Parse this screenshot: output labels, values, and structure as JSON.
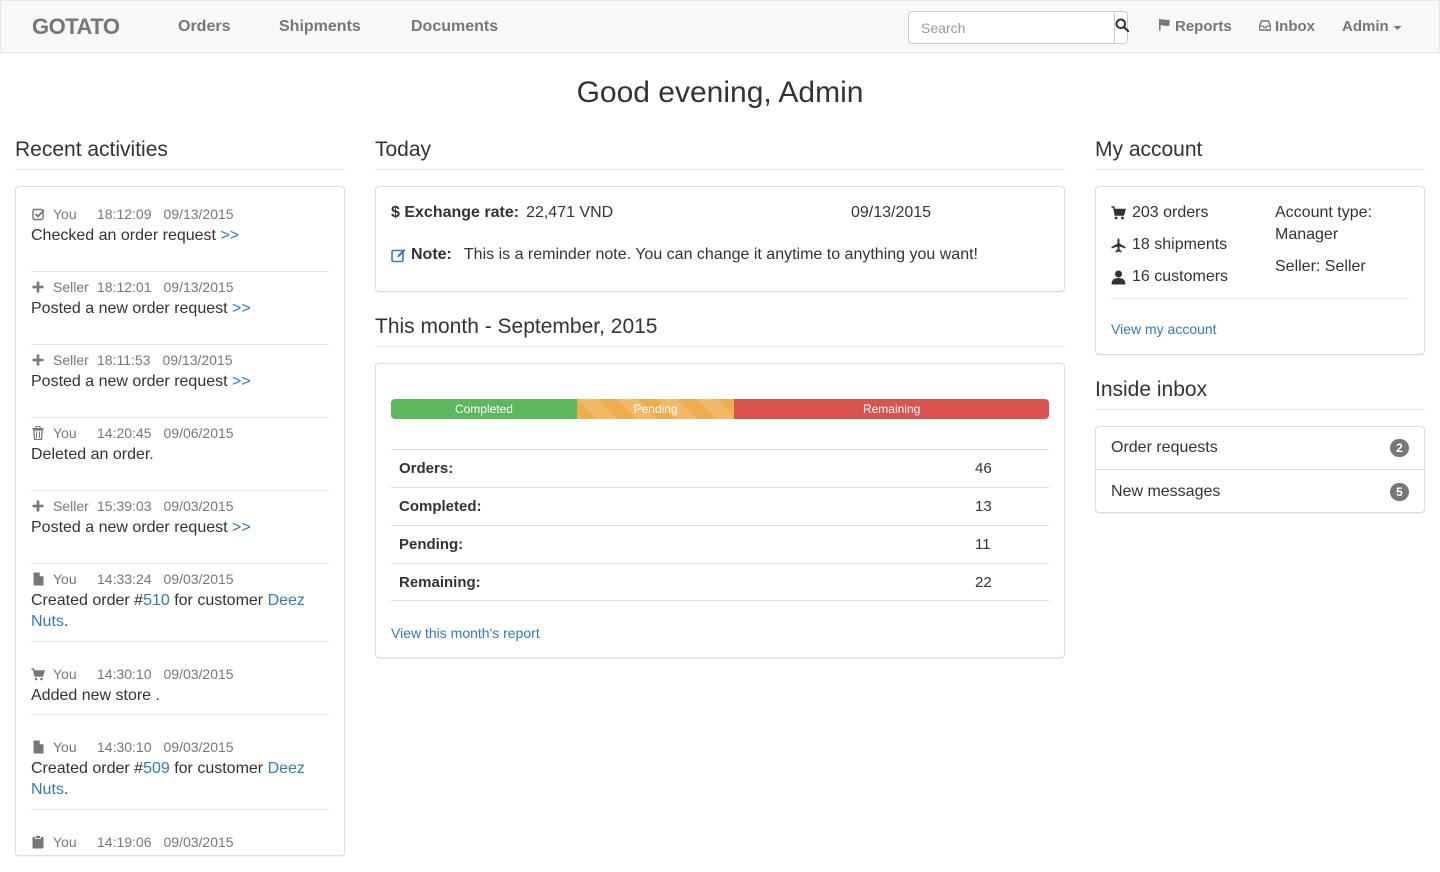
{
  "colors": {
    "link": "#337ab7",
    "completed": "#5cb85c",
    "pending": "#f0ad4e",
    "remaining": "#d9534f",
    "badge": "#777777"
  },
  "navbar": {
    "brand": "GOTATO",
    "links": [
      "Orders",
      "Shipments",
      "Documents"
    ],
    "search_placeholder": "Search",
    "search_icon": "search-icon",
    "reports": {
      "label": "Reports",
      "icon": "flag-icon"
    },
    "inbox": {
      "label": "Inbox",
      "icon": "inbox-icon"
    },
    "admin": {
      "label": "Admin",
      "icon": "caret-down-icon"
    }
  },
  "greeting": "Good evening, Admin",
  "recent": {
    "title": "Recent activities",
    "items": [
      {
        "icon": "check-square-icon",
        "who": "You",
        "time": "18:12:09",
        "date": "09/13/2015",
        "text": "Checked an order request ",
        "link": ">>"
      },
      {
        "icon": "plus-icon",
        "who": "Seller",
        "time": "18:12:01",
        "date": "09/13/2015",
        "text": "Posted a new order request ",
        "link": ">>"
      },
      {
        "icon": "plus-icon",
        "who": "Seller",
        "time": "18:11:53",
        "date": "09/13/2015",
        "text": "Posted a new order request ",
        "link": ">>"
      },
      {
        "icon": "trash-icon",
        "who": "You",
        "time": "14:20:45",
        "date": "09/06/2015",
        "text": "Deleted an order."
      },
      {
        "icon": "plus-icon",
        "who": "Seller",
        "time": "15:39:03",
        "date": "09/03/2015",
        "text": "Posted a new order request ",
        "link": ">>"
      },
      {
        "icon": "file-icon",
        "who": "You",
        "time": "14:33:24",
        "date": "09/03/2015",
        "pre": "Created order #",
        "order": "510",
        "mid": " for customer ",
        "customer": "Deez Nuts",
        "post": "."
      },
      {
        "icon": "cart-icon",
        "who": "You",
        "time": "14:30:10",
        "date": "09/03/2015",
        "text": "Added new store ."
      },
      {
        "icon": "file-icon",
        "who": "You",
        "time": "14:30:10",
        "date": "09/03/2015",
        "pre": "Created order #",
        "order": "509",
        "mid": " for customer ",
        "customer": "Deez Nuts",
        "post": "."
      },
      {
        "icon": "clipboard-icon",
        "who": "You",
        "time": "14:19:06",
        "date": "09/03/2015"
      }
    ]
  },
  "today": {
    "title": "Today",
    "exchange_label": "$ Exchange rate:",
    "exchange_value": "22,471 VND",
    "exchange_date": "09/13/2015",
    "note_label": "Note:",
    "note_text": "This is a reminder note. You can change it anytime to anything you want!"
  },
  "month": {
    "title": "This month - September, 2015",
    "progress": [
      {
        "label": "Completed",
        "value": 13
      },
      {
        "label": "Pending",
        "value": 11
      },
      {
        "label": "Remaining",
        "value": 22
      }
    ],
    "stats": [
      {
        "label": "Orders:",
        "value": "46"
      },
      {
        "label": "Completed:",
        "value": "13"
      },
      {
        "label": "Pending:",
        "value": "11"
      },
      {
        "label": "Remaining:",
        "value": "22"
      }
    ],
    "report_link": "View this month's report"
  },
  "account": {
    "title": "My account",
    "orders": "203 orders",
    "shipments": "18 shipments",
    "customers": "16 customers",
    "type_label": "Account type:",
    "type_value": "Manager",
    "seller": "Seller: Seller",
    "view_link": "View my account"
  },
  "inbox": {
    "title": "Inside inbox",
    "items": [
      {
        "label": "Order requests",
        "count": "2"
      },
      {
        "label": "New messages",
        "count": "5"
      }
    ]
  }
}
